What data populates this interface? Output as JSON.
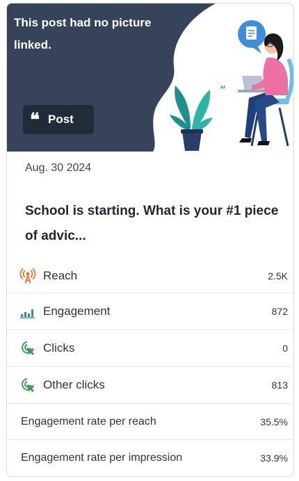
{
  "hero": {
    "message": "This post had no picture linked.",
    "badge_label": "Post"
  },
  "post": {
    "date": "Aug. 30 2024",
    "title": "School is starting. What is your #1 piece of advic..."
  },
  "metrics": [
    {
      "label": "Reach",
      "value": "2.5K",
      "icon": "broadcast-tower-icon"
    },
    {
      "label": "Engagement",
      "value": "872",
      "icon": "bar-chart-icon"
    },
    {
      "label": "Clicks",
      "value": "0",
      "icon": "cursor-click-icon"
    },
    {
      "label": "Other clicks",
      "value": "813",
      "icon": "cursor-click-icon"
    },
    {
      "label": "Engagement rate per reach",
      "value": "35.5%"
    },
    {
      "label": "Engagement rate per impression",
      "value": "33.9%"
    }
  ],
  "colors": {
    "hero_bg": "#36435a",
    "badge_bg": "#222b3a",
    "reach_icon": "#e8742c",
    "engagement_icon": "#3a82c4",
    "clicks_icon": "#3f9d59"
  }
}
